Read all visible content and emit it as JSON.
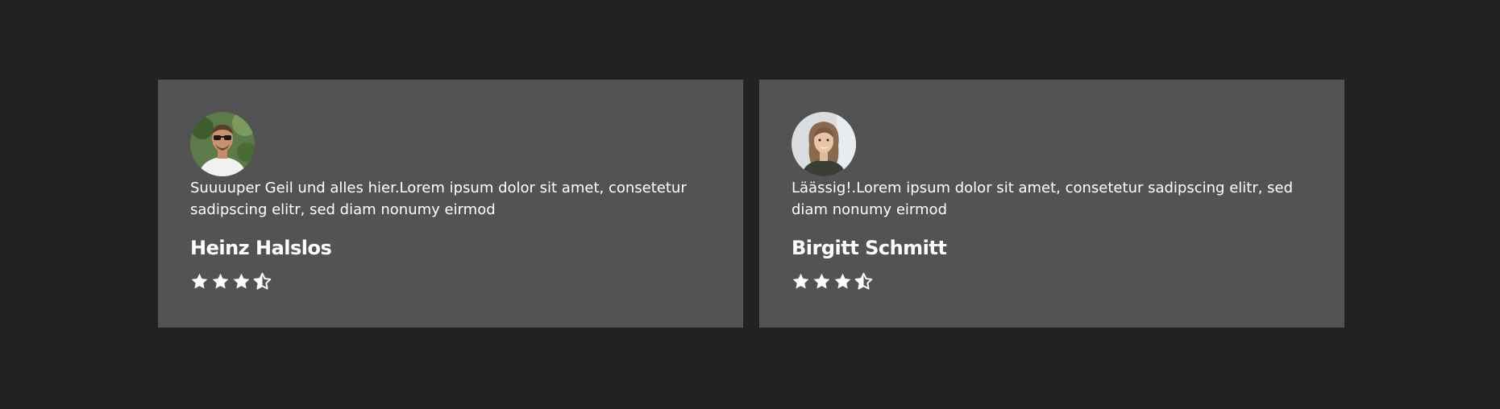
{
  "testimonials": [
    {
      "quote": "Suuuuper Geil und alles hier.Lorem ipsum dolor sit amet, consetetur sadipscing elitr, sed diam nonumy eirmod",
      "name": "Heinz Halslos",
      "rating": 3.5,
      "avatar_icon": "man-portrait-photo"
    },
    {
      "quote": "Läässig!.Lorem ipsum dolor sit amet, consetetur sadipscing elitr, sed diam nonumy eirmod",
      "name": "Birgitt Schmitt",
      "rating": 3.5,
      "avatar_icon": "woman-portrait-photo"
    }
  ],
  "colors": {
    "background": "#222222",
    "card": "#535353",
    "text": "#ffffff"
  }
}
